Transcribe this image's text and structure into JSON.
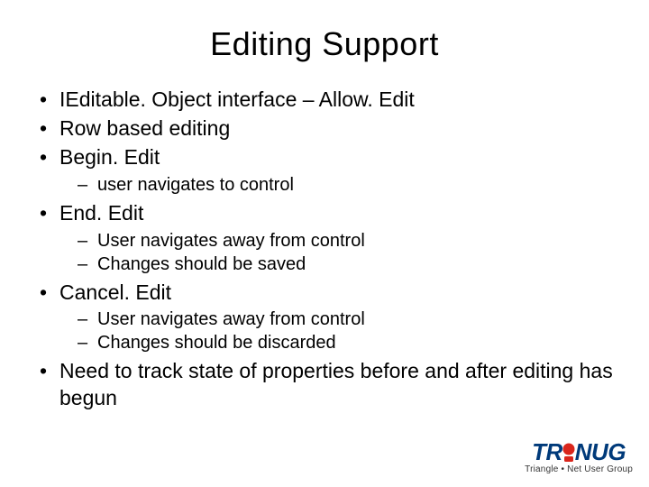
{
  "title": "Editing Support",
  "bullets": {
    "b1": "IEditable. Object interface – Allow. Edit",
    "b2": "Row based editing",
    "b3": "Begin. Edit",
    "b3_sub": {
      "s1": "user navigates to control"
    },
    "b4": "End. Edit",
    "b4_sub": {
      "s1": "User navigates away from control",
      "s2": "Changes should be saved"
    },
    "b5": "Cancel. Edit",
    "b5_sub": {
      "s1": "User navigates away from control",
      "s2": "Changes should be discarded"
    },
    "b6": "Need to track state of properties before and after editing has begun"
  },
  "logo": {
    "brand_left": "TR",
    "brand_right": "NUG",
    "tagline": "Triangle • Net User Group"
  }
}
